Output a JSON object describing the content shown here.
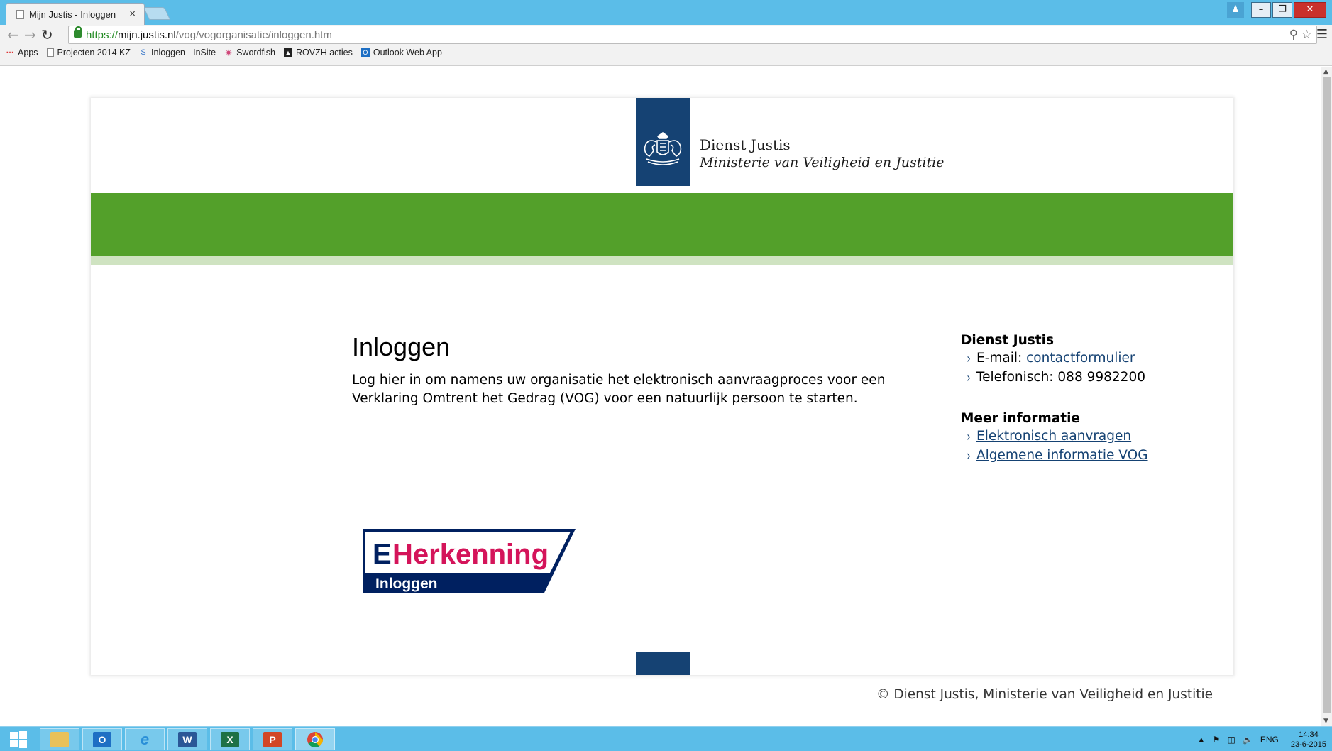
{
  "browser": {
    "tab_title": "Mijn Justis - Inloggen",
    "tab_close": "×",
    "url_scheme": "https://",
    "url_host": "mijn.justis.nl",
    "url_path": "/vog/vogorganisatie/inloggen.htm",
    "bookmarks": [
      {
        "label": "Apps",
        "icon": "apps-icon"
      },
      {
        "label": "Projecten 2014 KZ",
        "icon": "page-icon"
      },
      {
        "label": "Inloggen - InSite",
        "icon": "insite-icon"
      },
      {
        "label": "Swordfish",
        "icon": "swordfish-icon"
      },
      {
        "label": "ROVZH acties",
        "icon": "rovzh-icon"
      },
      {
        "label": "Outlook Web App",
        "icon": "outlook-icon"
      }
    ]
  },
  "header": {
    "org_name": "Dienst Justis",
    "ministry": "Ministerie van Veiligheid en Justitie"
  },
  "main": {
    "title": "Inloggen",
    "intro": "Log hier in om namens uw organisatie het elektronisch aanvraagproces voor een Verklaring Omtrent het Gedrag (VOG) voor een natuurlijk persoon te starten.",
    "eherkenning": {
      "brand_e": "E",
      "brand": "Herkenning",
      "action": "Inloggen"
    }
  },
  "sidebar": {
    "contact_heading": "Dienst Justis",
    "email_label": "E-mail: ",
    "email_link": "contactformulier",
    "phone": "Telefonisch: 088 9982200",
    "info_heading": "Meer informatie",
    "links": [
      "Elektronisch aanvragen",
      "Algemene informatie VOG"
    ]
  },
  "footer": {
    "copyright": "© Dienst Justis, Ministerie van Veiligheid en Justitie"
  },
  "taskbar": {
    "language": "ENG",
    "time": "14:34",
    "date": "23-6-2015"
  },
  "colors": {
    "rijksblauw": "#154273",
    "green": "#53a02a",
    "green_light": "#cfe3c1",
    "eherkenning_pink": "#d4145a",
    "eherkenning_navy": "#002060"
  }
}
